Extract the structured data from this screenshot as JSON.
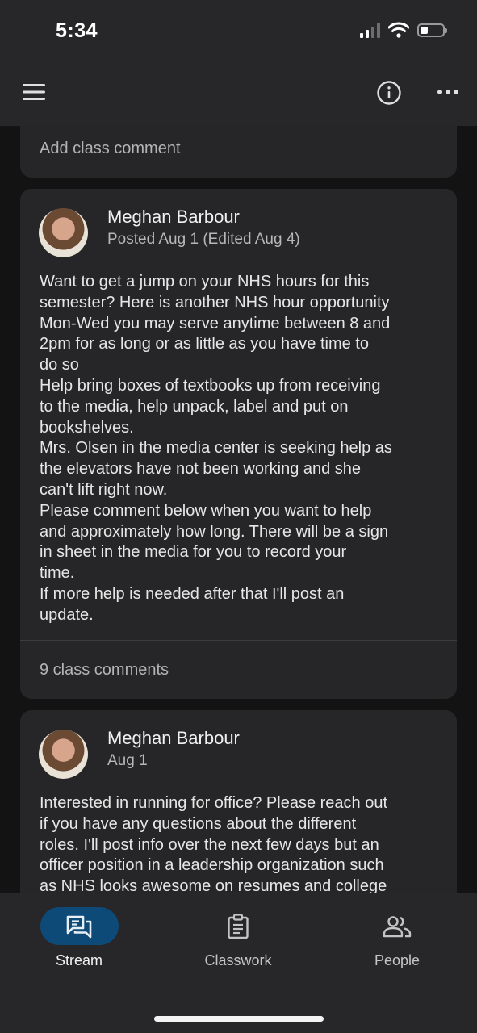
{
  "status_bar": {
    "time": "5:34"
  },
  "toolbar": {
    "icons": [
      "hamburger-menu-icon",
      "info-icon",
      "more-horizontal-icon"
    ]
  },
  "previous_card": {
    "comment_placeholder": "Add class comment"
  },
  "posts": [
    {
      "author": "Meghan Barbour",
      "date": "Posted Aug 1 (Edited Aug 4)",
      "lines": [
        "Want to get a jump on your NHS hours for this",
        "semester? Here is another NHS hour opportunity",
        "Mon-Wed you may serve anytime between 8 and",
        "2pm for as long or as little as you have time to",
        "do so",
        "Help bring boxes of textbooks up from receiving",
        "to the media, help unpack, label and put on",
        "bookshelves.",
        "Mrs. Olsen in the media center is seeking help as",
        "the elevators have not been working and she",
        "can't lift right now.",
        "Please comment below when you want to help",
        "and approximately how long. There will be a sign",
        "in sheet in the media for you to record your",
        "time.",
        "If more help is needed after that I'll post an",
        "update."
      ],
      "comments": "9 class comments"
    },
    {
      "author": "Meghan Barbour",
      "date": "Aug 1",
      "lines": [
        "Interested in running for office? Please reach out",
        "if you have any questions about the different",
        "roles. I'll post info over the next few days but an",
        "officer position in a leadership organization such",
        "as NHS looks awesome on resumes and college"
      ]
    }
  ],
  "bottom_nav": [
    {
      "label": "Stream",
      "icon": "stream-chat-icon",
      "active": true
    },
    {
      "label": "Classwork",
      "icon": "clipboard-icon",
      "active": false
    },
    {
      "label": "People",
      "icon": "people-icon",
      "active": false
    }
  ],
  "colors": {
    "background": "#131314",
    "card": "#262628",
    "accent": "#0e4a78",
    "bars": "#272729"
  }
}
